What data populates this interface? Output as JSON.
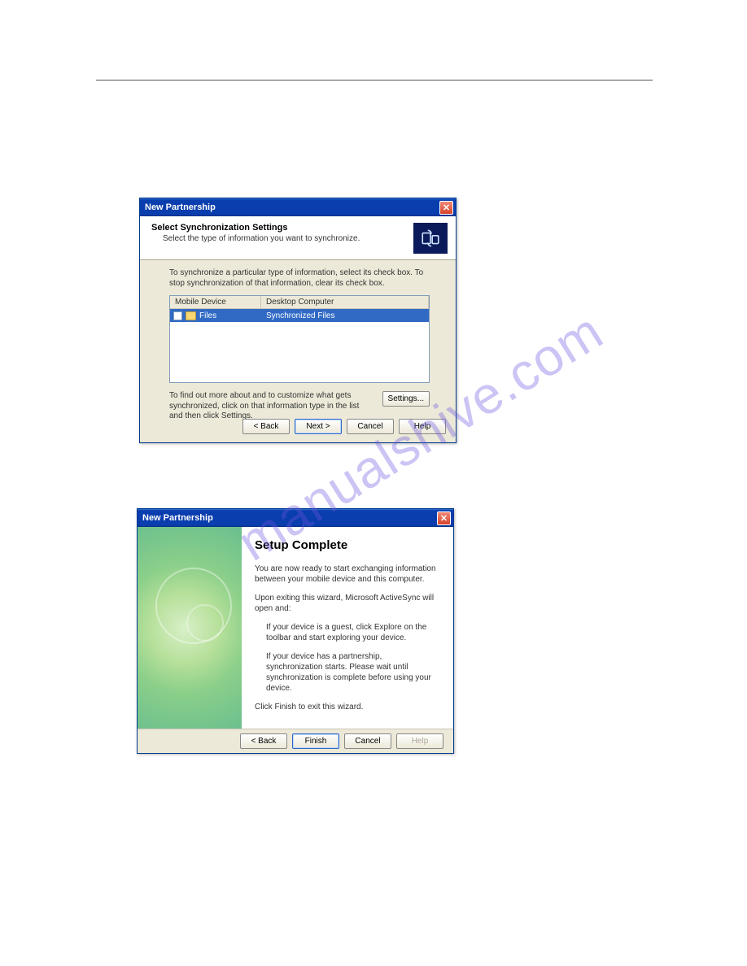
{
  "watermark": "manualshive.com",
  "dialog1": {
    "title": "New Partnership",
    "header": {
      "headline": "Select Synchronization Settings",
      "sub": "Select the type of information you want to synchronize."
    },
    "instructions": "To synchronize a particular type of information, select its check box. To stop synchronization of that information, clear its check box.",
    "columns": {
      "col1": "Mobile Device",
      "col2": "Desktop Computer"
    },
    "row": {
      "name": "Files",
      "target": "Synchronized Files"
    },
    "settings_text": "To find out more about and to customize what gets synchronized, click on that information type in the list and then click Settings.",
    "buttons": {
      "settings": "Settings...",
      "back": "< Back",
      "next": "Next >",
      "cancel": "Cancel",
      "help": "Help"
    }
  },
  "dialog2": {
    "title": "New Partnership",
    "heading": "Setup Complete",
    "para1": "You are now ready to start exchanging information between your mobile device and this computer.",
    "para2": "Upon exiting this wizard, Microsoft ActiveSync will open and:",
    "bullet1": "If your device is a guest, click Explore on the toolbar and start exploring your device.",
    "bullet2": "If your device has a partnership, synchronization starts. Please wait until synchronization is complete before using your device.",
    "para3": "Click Finish to exit this wizard.",
    "buttons": {
      "back": "< Back",
      "finish": "Finish",
      "cancel": "Cancel",
      "help": "Help"
    }
  }
}
